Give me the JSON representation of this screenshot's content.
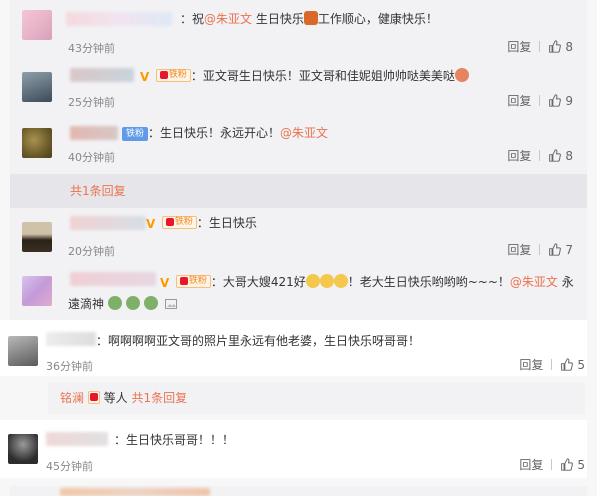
{
  "comments": [
    {
      "text_parts": [
        "：祝",
        "@朱亚文",
        " 生日快乐",
        "工作顺心，健康快乐！"
      ],
      "time": "43分钟前",
      "reply": "回复",
      "likes": "8"
    },
    {
      "badge_fan": "铁粉",
      "text": "：亚文哥生日快乐！亚文哥和佳妮姐帅帅哒美美哒",
      "time": "25分钟前",
      "reply": "回复",
      "likes": "9"
    },
    {
      "badge_iron": "铁粉",
      "text_parts": [
        "：生日快乐！永远开心！",
        "@朱亚文"
      ],
      "time": "40分钟前",
      "reply": "回复",
      "likes": "8"
    },
    {
      "badge_fan": "铁粉",
      "text": "：生日快乐",
      "time": "20分钟前",
      "reply": "回复",
      "likes": "7"
    },
    {
      "badge_fan": "铁粉",
      "text_parts": [
        "：大哥大嫂421好",
        "！老大生日快乐哟哟哟~~~！",
        "@朱亚文",
        "永"
      ],
      "line2": "遠滴神",
      "time": "",
      "reply": "",
      "likes": ""
    },
    {
      "text": "：啊啊啊啊亚文哥的照片里永远有他老婆，生日快乐呀哥哥！",
      "time": "36分钟前",
      "reply": "回复",
      "likes": "5"
    },
    {
      "text": "：生日快乐哥哥！！！",
      "time": "45分钟前",
      "reply": "回复",
      "likes": "5"
    }
  ],
  "reply_more_1": "共1条回复",
  "reply_more_2": {
    "name": "铭澜",
    "suffix": "等人",
    "count": "共1条回复"
  },
  "colors": {
    "mention": "#eb7350",
    "panel_bg": "#f2f2f5",
    "badge_blue": "#5f9be8",
    "badge_orange": "#f08a24"
  },
  "icons": [
    "thumb-up-icon",
    "v-verified-icon",
    "crown-icon",
    "cake-emoji-icon",
    "laugh-emoji-icon",
    "angry-emoji-icon"
  ]
}
